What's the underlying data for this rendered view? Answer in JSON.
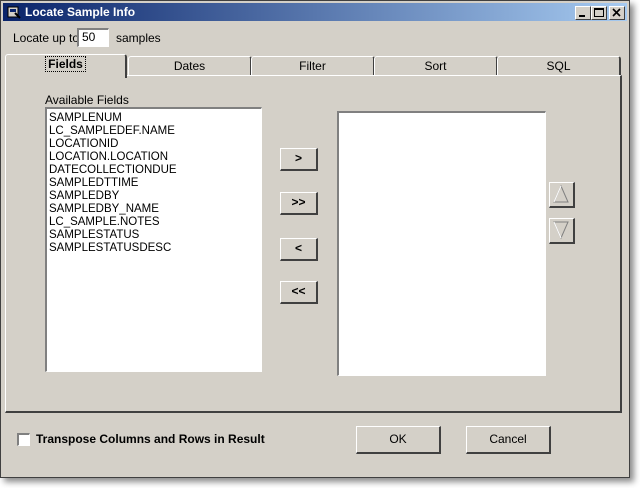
{
  "window": {
    "title": "Locate Sample Info"
  },
  "limit": {
    "prefix": "Locate up to",
    "value": "50",
    "suffix": "samples"
  },
  "tabs": [
    {
      "label": "Fields",
      "active": true
    },
    {
      "label": "Dates"
    },
    {
      "label": "Filter"
    },
    {
      "label": "Sort"
    },
    {
      "label": "SQL"
    }
  ],
  "fields": {
    "available_label": "Available Fields",
    "available": [
      "SAMPLENUM",
      "LC_SAMPLEDEF.NAME",
      "LOCATIONID",
      "LOCATION.LOCATION",
      "DATECOLLECTIONDUE",
      "SAMPLEDTTIME",
      "SAMPLEDBY",
      "SAMPLEDBY_NAME",
      "LC_SAMPLE.NOTES",
      "SAMPLESTATUS",
      "SAMPLESTATUSDESC"
    ],
    "selected": []
  },
  "move_buttons": {
    "add": ">",
    "add_all": ">>",
    "remove": "<",
    "remove_all": "<<"
  },
  "footer": {
    "transpose_label": "Transpose Columns and Rows in Result",
    "transpose_checked": false,
    "ok": "OK",
    "cancel": "Cancel"
  }
}
